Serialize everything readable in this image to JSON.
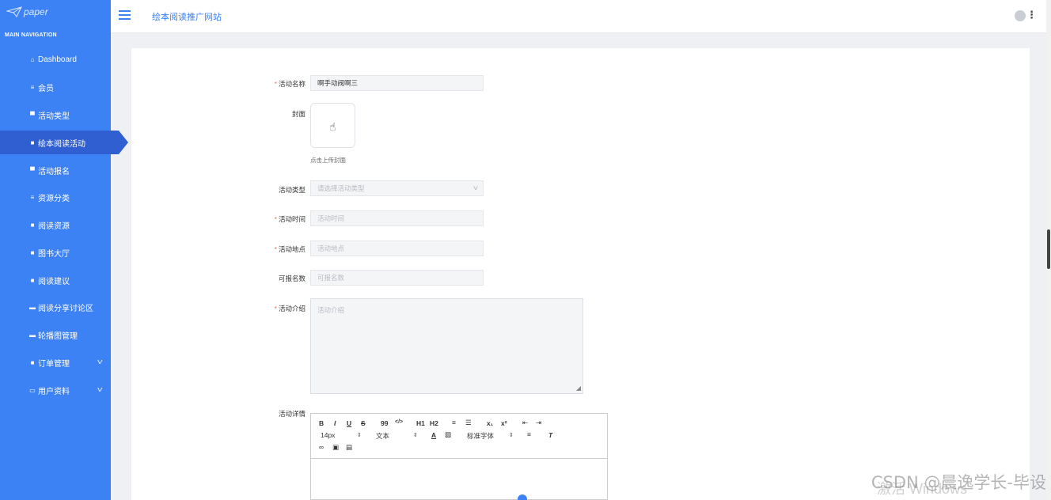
{
  "app": {
    "logo_text": "paper",
    "site_title": "绘本阅读推广网站",
    "nav_header": "MAIN NAVIGATION"
  },
  "sidebar": {
    "items": [
      {
        "label": "Dashboard",
        "icon": "home-icon"
      },
      {
        "label": "会员",
        "icon": "list-icon"
      },
      {
        "label": "活动类型",
        "icon": "comment-icon"
      },
      {
        "label": "绘本阅读活动",
        "icon": "grid-icon",
        "active": true
      },
      {
        "label": "活动报名",
        "icon": "comment-icon"
      },
      {
        "label": "资源分类",
        "icon": "list-icon"
      },
      {
        "label": "阅读资源",
        "icon": "grid-icon"
      },
      {
        "label": "图书大厅",
        "icon": "grid-icon"
      },
      {
        "label": "阅读建议",
        "icon": "grid-icon"
      },
      {
        "label": "阅读分享讨论区",
        "icon": "chat-icon"
      },
      {
        "label": "轮播图管理",
        "icon": "chat-icon"
      },
      {
        "label": "订单管理",
        "icon": "grid-icon",
        "expandable": true
      },
      {
        "label": "用户资料",
        "icon": "calendar-icon",
        "expandable": true
      }
    ]
  },
  "form": {
    "name": {
      "label": "活动名称",
      "required": true,
      "value": "啊手动阀啊三"
    },
    "cover": {
      "label": "封面",
      "hint": "点击上传封面"
    },
    "type": {
      "label": "活动类型",
      "placeholder": "请选择活动类型"
    },
    "time": {
      "label": "活动时间",
      "required": true,
      "placeholder": "活动时间"
    },
    "place": {
      "label": "活动地点",
      "required": true,
      "placeholder": "活动地点"
    },
    "quota": {
      "label": "可报名数",
      "placeholder": "可报名数"
    },
    "intro": {
      "label": "活动介绍",
      "required": true,
      "placeholder": "活动介绍"
    },
    "detail": {
      "label": "活动详情"
    }
  },
  "editor": {
    "row1": [
      "B",
      "I",
      "U",
      "S",
      "99",
      "</>",
      "H1",
      "H2",
      "≡",
      "☰",
      "x₁",
      "x²",
      "⇤",
      "⇥"
    ],
    "font_size": "14px",
    "text_type": "文本",
    "font_family": "标准字体",
    "row3": [
      "link",
      "image",
      "video"
    ]
  },
  "watermark": {
    "text": "CSDN @晨逸学长-毕设",
    "windows": "激活 Windows"
  },
  "colors": {
    "sidebar": "#3d82f5",
    "active": "#2f5fd0",
    "required": "#f56c6c"
  }
}
